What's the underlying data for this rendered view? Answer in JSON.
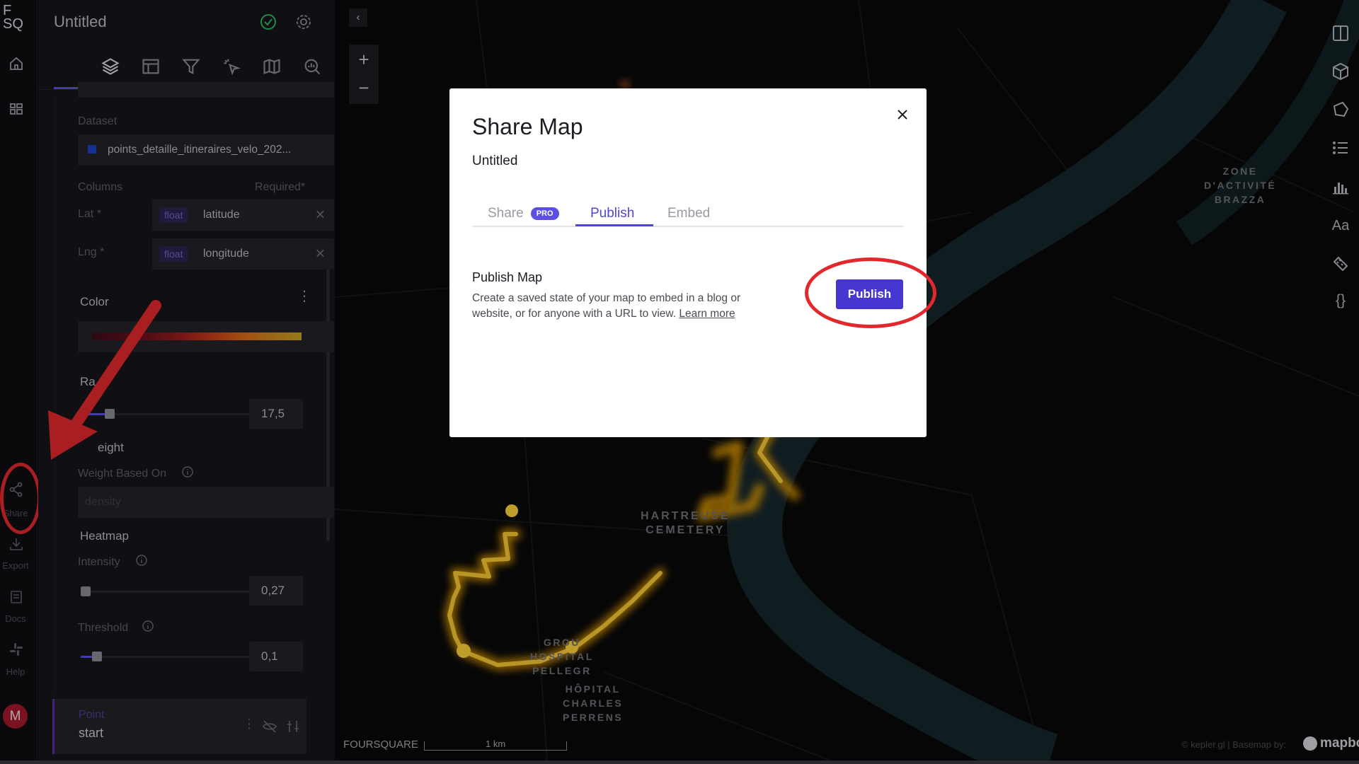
{
  "rail": {
    "logo_top": "F",
    "logo_bottom": "SQ",
    "items": [
      {
        "label": "",
        "icon": "home-icon"
      },
      {
        "label": "",
        "icon": "grid-icon"
      },
      {
        "label": "Share",
        "icon": "share-icon"
      },
      {
        "label": "Export",
        "icon": "export-icon"
      },
      {
        "label": "Docs",
        "icon": "docs-icon"
      },
      {
        "label": "Help",
        "icon": "slack-icon"
      }
    ],
    "avatar": "M"
  },
  "panel": {
    "title": "Untitled",
    "dataset_label": "Dataset",
    "dataset_value": "points_detaille_itineraires_velo_202...",
    "dataset_color": "#1d3fc4",
    "columns_label": "Columns",
    "required_label": "Required*",
    "lat_label": "Lat *",
    "lat_type": "float",
    "lat_value": "latitude",
    "lng_label": "Lng *",
    "lng_type": "float",
    "lng_value": "longitude",
    "color_label": "Color",
    "radius_label": "Ra",
    "radius_value": "17,5",
    "weight_label": "eight",
    "weight_based_on_label": "Weight Based On",
    "weight_based_on_placeholder": "density",
    "heatmap_label": "Heatmap",
    "intensity_label": "Intensity",
    "intensity_value": "0,27",
    "threshold_label": "Threshold",
    "threshold_value": "0,1",
    "point_type": "Point",
    "point_name": "start"
  },
  "map": {
    "labels": {
      "zone": "ZONE\nD'ACTIVITÉ\nBRAZZA",
      "cemetery": "HARTREUSE\nCEMETERY",
      "grou": "GROU\nHOSPITAL\nPELLEGR",
      "hopital": "HÔPITAL\nCHARLES\nPERRENS"
    },
    "attribution_left": "FOURSQUARE",
    "scale": "1 km",
    "attribution_right": "© kepler.gl | Basemap by:",
    "mapbox": "mapbo"
  },
  "modal": {
    "title": "Share Map",
    "subtitle": "Untitled",
    "tabs": [
      {
        "label": "Share",
        "badge": "PRO"
      },
      {
        "label": "Publish"
      },
      {
        "label": "Embed"
      }
    ],
    "active_tab": "Publish",
    "section_title": "Publish Map",
    "section_desc": "Create a saved state of your map to embed in a blog or website, or for anyone with a URL to view.",
    "learn_more": "Learn more",
    "publish_button": "Publish"
  },
  "colors": {
    "accent": "#4f46d8",
    "annotation_red": "#e2282d",
    "heat_yellow": "#f0b400"
  }
}
